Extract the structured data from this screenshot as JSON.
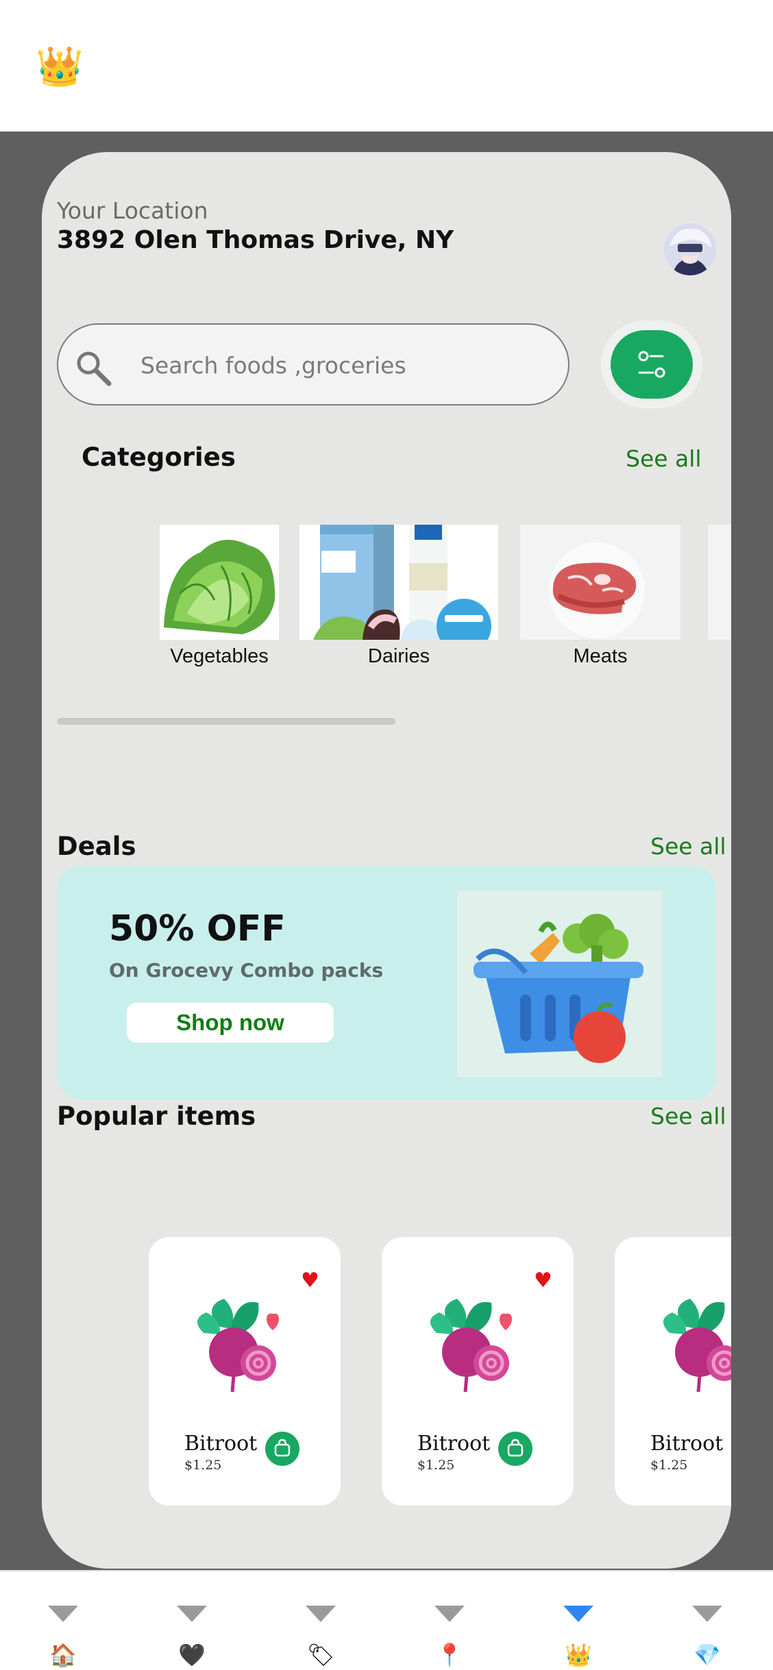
{
  "header": {
    "logo_icon": "crown-icon",
    "logo_glyph": "👑"
  },
  "location": {
    "label": "Your Location",
    "address": "3892 Olen Thomas Drive, NY"
  },
  "search": {
    "placeholder": "Search foods ,groceries"
  },
  "categories": {
    "title": "Categories",
    "see_all": "See all",
    "items": [
      {
        "label": "Vegetables",
        "icon": "lettuce-icon"
      },
      {
        "label": "Dairies",
        "icon": "milk-icon"
      },
      {
        "label": "Meats",
        "icon": "steak-icon"
      }
    ]
  },
  "deals": {
    "title": "Deals",
    "see_all": "See all",
    "banner": {
      "headline": "50% OFF",
      "subtitle": "On Grocevy Combo packs",
      "button": "Shop now",
      "image_icon": "grocery-basket-icon"
    }
  },
  "popular": {
    "title": "Popular items",
    "see_all": "See all",
    "items": [
      {
        "name": "Bitroot",
        "price": "$1.25",
        "favorite": true
      },
      {
        "name": "Bitroot",
        "price": "$1.25",
        "favorite": true
      },
      {
        "name": "Bitroot",
        "price": "$1.25",
        "favorite": true
      }
    ]
  },
  "bottom_nav": {
    "active_index": 4,
    "items": [
      {
        "icon": "home-icon",
        "glyph": "🏠"
      },
      {
        "icon": "heart-icon",
        "glyph": "🖤"
      },
      {
        "icon": "tag-icon",
        "glyph": "🏷"
      },
      {
        "icon": "pin-icon",
        "glyph": "📍"
      },
      {
        "icon": "crown-icon",
        "glyph": "👑"
      },
      {
        "icon": "diamond-icon",
        "glyph": "💎"
      }
    ]
  },
  "colors": {
    "accent_green": "#19a862",
    "link_green": "#1b7a1b",
    "deal_bg": "#c9efec",
    "active_nav": "#2f86f0",
    "heart_red": "#e0131b"
  }
}
